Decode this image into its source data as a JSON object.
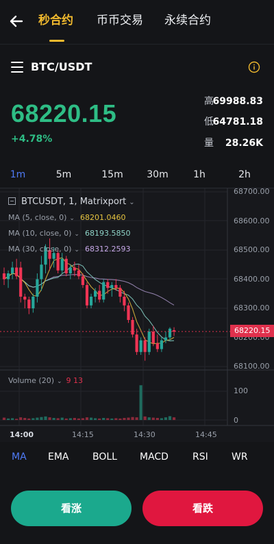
{
  "nav": {
    "tabs": [
      {
        "label": "秒合约",
        "active": true
      },
      {
        "label": "币币交易",
        "active": false
      },
      {
        "label": "永续合约",
        "active": false
      }
    ]
  },
  "pair": {
    "symbol": "BTC/USDT"
  },
  "ticker": {
    "price": "68220.15",
    "change": "+4.78%",
    "stats": [
      {
        "label": "高",
        "value": "69988.83"
      },
      {
        "label": "低",
        "value": "64781.18"
      },
      {
        "label": "量",
        "value": "28.26K"
      }
    ]
  },
  "intervals": [
    {
      "label": "1m",
      "active": true
    },
    {
      "label": "5m",
      "active": false
    },
    {
      "label": "15m",
      "active": false
    },
    {
      "label": "30m",
      "active": false
    },
    {
      "label": "1h",
      "active": false
    },
    {
      "label": "2h",
      "active": false
    }
  ],
  "chart": {
    "symbol_line": "BTCUSDT, 1, Matrixport",
    "ma_legend": [
      {
        "label": "MA (5, close, 0)",
        "value": "68201.0460",
        "color": "#e6c440"
      },
      {
        "label": "MA (10, close, 0)",
        "value": "68193.5850",
        "color": "#8fd3c8"
      },
      {
        "label": "MA (30, close, 0)",
        "value": "68312.2593",
        "color": "#c5a7e6"
      }
    ],
    "current_price_tag": "68220.15",
    "volume_legend": {
      "label": "Volume (20)",
      "value": "9 13"
    },
    "time_labels": [
      "14:00",
      "14:15",
      "14:30",
      "14:45"
    ],
    "up_color": "#26a69a",
    "down_color": "#ef3454"
  },
  "chart_data": {
    "type": "candlestick",
    "title": "BTCUSDT, 1, Matrixport",
    "price_axis": {
      "ticks": [
        "68700.00",
        "68600.00",
        "68500.00",
        "68400.00",
        "68300.00",
        "68200.00",
        "68100.00"
      ],
      "ylim": [
        68100,
        68700
      ]
    },
    "volume_axis": {
      "ticks": [
        "100",
        "0"
      ]
    },
    "x_ticks": [
      "14:00",
      "14:15",
      "14:30",
      "14:45"
    ],
    "candles": [
      {
        "o": 68420,
        "h": 68440,
        "l": 68380,
        "c": 68400
      },
      {
        "o": 68400,
        "h": 68430,
        "l": 68370,
        "c": 68420
      },
      {
        "o": 68420,
        "h": 68460,
        "l": 68400,
        "c": 68440
      },
      {
        "o": 68440,
        "h": 68470,
        "l": 68400,
        "c": 68410
      },
      {
        "o": 68440,
        "h": 68460,
        "l": 68320,
        "c": 68340
      },
      {
        "o": 68340,
        "h": 68350,
        "l": 68300,
        "c": 68330
      },
      {
        "o": 68330,
        "h": 68340,
        "l": 68280,
        "c": 68300
      },
      {
        "o": 68300,
        "h": 68350,
        "l": 68285,
        "c": 68340
      },
      {
        "o": 68340,
        "h": 68420,
        "l": 68320,
        "c": 68400
      },
      {
        "o": 68400,
        "h": 68480,
        "l": 68360,
        "c": 68450
      },
      {
        "o": 68450,
        "h": 68520,
        "l": 68420,
        "c": 68510
      },
      {
        "o": 68500,
        "h": 68540,
        "l": 68430,
        "c": 68470
      },
      {
        "o": 68470,
        "h": 68510,
        "l": 68440,
        "c": 68490
      },
      {
        "o": 68490,
        "h": 68500,
        "l": 68420,
        "c": 68430
      },
      {
        "o": 68430,
        "h": 68490,
        "l": 68420,
        "c": 68470
      },
      {
        "o": 68470,
        "h": 68480,
        "l": 68410,
        "c": 68420
      },
      {
        "o": 68420,
        "h": 68450,
        "l": 68400,
        "c": 68440
      },
      {
        "o": 68440,
        "h": 68460,
        "l": 68410,
        "c": 68430
      },
      {
        "o": 68430,
        "h": 68450,
        "l": 68400,
        "c": 68410
      },
      {
        "o": 68410,
        "h": 68420,
        "l": 68370,
        "c": 68380
      },
      {
        "o": 68380,
        "h": 68390,
        "l": 68300,
        "c": 68310
      },
      {
        "o": 68310,
        "h": 68350,
        "l": 68300,
        "c": 68340
      },
      {
        "o": 68340,
        "h": 68370,
        "l": 68320,
        "c": 68360
      },
      {
        "o": 68360,
        "h": 68380,
        "l": 68320,
        "c": 68330
      },
      {
        "o": 68330,
        "h": 68400,
        "l": 68320,
        "c": 68390
      },
      {
        "o": 68390,
        "h": 68400,
        "l": 68350,
        "c": 68370
      },
      {
        "o": 68370,
        "h": 68390,
        "l": 68340,
        "c": 68380
      },
      {
        "o": 68380,
        "h": 68400,
        "l": 68360,
        "c": 68370
      },
      {
        "o": 68370,
        "h": 68380,
        "l": 68320,
        "c": 68340
      },
      {
        "o": 68340,
        "h": 68360,
        "l": 68290,
        "c": 68310
      },
      {
        "o": 68310,
        "h": 68320,
        "l": 68250,
        "c": 68260
      },
      {
        "o": 68260,
        "h": 68270,
        "l": 68200,
        "c": 68210
      },
      {
        "o": 68210,
        "h": 68230,
        "l": 68140,
        "c": 68150
      },
      {
        "o": 68150,
        "h": 68200,
        "l": 68140,
        "c": 68190
      },
      {
        "o": 68190,
        "h": 68200,
        "l": 68120,
        "c": 68150
      },
      {
        "o": 68150,
        "h": 68230,
        "l": 68140,
        "c": 68220
      },
      {
        "o": 68220,
        "h": 68240,
        "l": 68170,
        "c": 68180
      },
      {
        "o": 68180,
        "h": 68210,
        "l": 68150,
        "c": 68160
      },
      {
        "o": 68160,
        "h": 68200,
        "l": 68150,
        "c": 68190
      },
      {
        "o": 68190,
        "h": 68220,
        "l": 68180,
        "c": 68200
      },
      {
        "o": 68200,
        "h": 68235,
        "l": 68190,
        "c": 68230
      },
      {
        "o": 68225,
        "h": 68235,
        "l": 68205,
        "c": 68220
      }
    ],
    "volumes": [
      8,
      5,
      6,
      4,
      9,
      7,
      5,
      6,
      8,
      10,
      12,
      9,
      7,
      6,
      8,
      5,
      6,
      7,
      5,
      6,
      9,
      8,
      6,
      5,
      7,
      6,
      5,
      6,
      5,
      7,
      8,
      10,
      9,
      118,
      12,
      9,
      8,
      7,
      6,
      9,
      13,
      9
    ],
    "ma_lines": [
      {
        "name": "MA (5, close, 0)",
        "value": "68201.0460"
      },
      {
        "name": "MA (10, close, 0)",
        "value": "68193.5850"
      },
      {
        "name": "MA (30, close, 0)",
        "value": "68312.2593"
      }
    ]
  },
  "indicators": [
    {
      "label": "MA",
      "active": true
    },
    {
      "label": "EMA",
      "active": false
    },
    {
      "label": "BOLL",
      "active": false
    },
    {
      "label": "MACD",
      "active": false
    },
    {
      "label": "RSI",
      "active": false
    },
    {
      "label": "WR",
      "active": false
    }
  ],
  "actions": {
    "up_label": "看涨",
    "down_label": "看跌"
  }
}
